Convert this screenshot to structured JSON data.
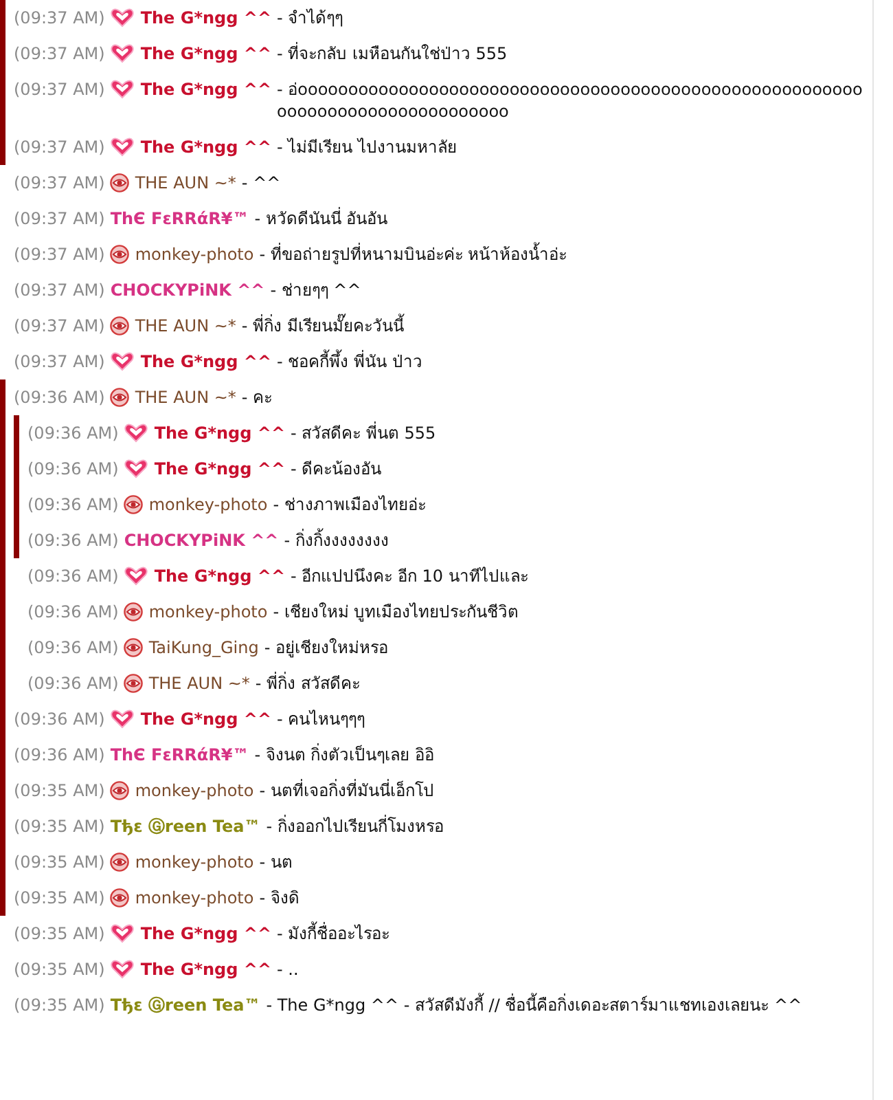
{
  "blocks": [
    {
      "quoted": true,
      "messages": [
        {
          "time": "(09:37 AM)",
          "kind": "heart",
          "sender": "The G*ngg ^^",
          "color": "#c8102e",
          "bold": true,
          "text": "- จำได้ๆๆ"
        },
        {
          "time": "(09:37 AM)",
          "kind": "heart",
          "sender": "The G*ngg ^^",
          "color": "#c8102e",
          "bold": true,
          "text": "- ที่จะกลับ เมหือนกันใช่ป่าว 555"
        },
        {
          "time": "(09:37 AM)",
          "kind": "heart",
          "sender": "The G*ngg ^^",
          "color": "#c8102e",
          "bold": true,
          "text": "- อ่ooooooooooooooooooooooooooooooooooooooooooooooooooooooooooooooooooooooooooooooo"
        },
        {
          "time": "(09:37 AM)",
          "kind": "heart",
          "sender": "The G*ngg ^^",
          "color": "#c8102e",
          "bold": true,
          "text": "- ไม่มีเรียน ไปงานมหาลัย"
        }
      ]
    },
    {
      "quoted": false,
      "messages": [
        {
          "time": "(09:37 AM)",
          "kind": "eye",
          "sender": "THE AUN ~*",
          "color": "#7a4a2a",
          "bold": false,
          "text": "- ^^"
        },
        {
          "time": "(09:37 AM)",
          "kind": "plain",
          "sender": "ThЄ FεRRάR¥™",
          "color": "#d63384",
          "bold": true,
          "text": "- หวัดดีนันนี่ อันอัน"
        },
        {
          "time": "(09:37 AM)",
          "kind": "eye",
          "sender": "monkey-photo",
          "color": "#7a4a2a",
          "bold": false,
          "text": "- ที่ขอถ่ายรูปที่หนามบินอ่ะค่ะ หน้าห้องน้ำอ่ะ"
        },
        {
          "time": "(09:37 AM)",
          "kind": "plain",
          "sender": "CHOCKYPiNK ^^",
          "color": "#d63384",
          "bold": true,
          "text": "- ช่ายๆๆ ^^"
        },
        {
          "time": "(09:37 AM)",
          "kind": "eye",
          "sender": "THE AUN ~*",
          "color": "#7a4a2a",
          "bold": false,
          "text": "- พี่กิ่ง มีเรียนมั๊ยคะวันนี้"
        },
        {
          "time": "(09:37 AM)",
          "kind": "heart",
          "sender": "The G*ngg ^^",
          "color": "#c8102e",
          "bold": true,
          "text": "- ชอคกี้พึ้ง พี่นัน ป่าว"
        }
      ]
    },
    {
      "quoted": true,
      "messages": [
        {
          "time": "(09:36 AM)",
          "kind": "eye",
          "sender": "THE AUN ~*",
          "color": "#7a4a2a",
          "bold": false,
          "text": "- คะ"
        }
      ],
      "children": [
        {
          "quoted": true,
          "messages": [
            {
              "time": "(09:36 AM)",
              "kind": "heart",
              "sender": "The G*ngg ^^",
              "color": "#c8102e",
              "bold": true,
              "text": "- สวัสดีคะ พี่นต 555"
            },
            {
              "time": "(09:36 AM)",
              "kind": "heart",
              "sender": "The G*ngg ^^",
              "color": "#c8102e",
              "bold": true,
              "text": "- ดีคะน้องอัน"
            },
            {
              "time": "(09:36 AM)",
              "kind": "eye",
              "sender": "monkey-photo",
              "color": "#7a4a2a",
              "bold": false,
              "text": "- ช่างภาพเมืองไทยอ่ะ"
            },
            {
              "time": "(09:36 AM)",
              "kind": "plain",
              "sender": "CHOCKYPiNK ^^",
              "color": "#d63384",
              "bold": true,
              "text": "- กิ่งกิ้งงงงงงงง"
            }
          ]
        },
        {
          "quoted": false,
          "messages": [
            {
              "time": "(09:36 AM)",
              "kind": "heart",
              "sender": "The G*ngg ^^",
              "color": "#c8102e",
              "bold": true,
              "text": "- อีกแปปนึงคะ อีก 10 นาทีไปและ"
            },
            {
              "time": "(09:36 AM)",
              "kind": "eye",
              "sender": "monkey-photo",
              "color": "#7a4a2a",
              "bold": false,
              "text": "- เชียงใหม่ บูทเมืองไทยประกันชีวิต"
            },
            {
              "time": "(09:36 AM)",
              "kind": "eye",
              "sender": "TaiKung_Ging",
              "color": "#7a4a2a",
              "bold": false,
              "text": "- อยู่เชียงใหม่หรอ"
            },
            {
              "time": "(09:36 AM)",
              "kind": "eye",
              "sender": "THE AUN ~*",
              "color": "#7a4a2a",
              "bold": false,
              "text": "- พี่กิ่ง สวัสดีคะ"
            }
          ]
        }
      ]
    },
    {
      "quoted": true,
      "messages": [
        {
          "time": "(09:36 AM)",
          "kind": "heart",
          "sender": "The G*ngg ^^",
          "color": "#c8102e",
          "bold": true,
          "text": "- คนไหนๆๆๆ"
        },
        {
          "time": "(09:36 AM)",
          "kind": "plain",
          "sender": "ThЄ FεRRάR¥™",
          "color": "#d63384",
          "bold": true,
          "text": "- จิงนต กิ่งตัวเป็นๆเลย อิอิ"
        },
        {
          "time": "(09:35 AM)",
          "kind": "eye",
          "sender": "monkey-photo",
          "color": "#7a4a2a",
          "bold": false,
          "text": "- นตที่เจอกิ่งที่มันนี่เอ็กโป"
        },
        {
          "time": "(09:35 AM)",
          "kind": "plain",
          "sender": "Tђε Ⓖreen Tea™",
          "color": "#8a8a12",
          "bold": true,
          "text": "- กิ่งออกไปเรียนกี่โมงหรอ"
        },
        {
          "time": "(09:35 AM)",
          "kind": "eye",
          "sender": "monkey-photo",
          "color": "#7a4a2a",
          "bold": false,
          "text": "- นต"
        },
        {
          "time": "(09:35 AM)",
          "kind": "eye",
          "sender": "monkey-photo",
          "color": "#7a4a2a",
          "bold": false,
          "text": "- จิงดิ"
        }
      ]
    },
    {
      "quoted": false,
      "messages": [
        {
          "time": "(09:35 AM)",
          "kind": "heart",
          "sender": "The G*ngg ^^",
          "color": "#c8102e",
          "bold": true,
          "text": "- มังกี้ชื่ออะไรอะ"
        },
        {
          "time": "(09:35 AM)",
          "kind": "heart",
          "sender": "The G*ngg ^^",
          "color": "#c8102e",
          "bold": true,
          "text": "- .."
        },
        {
          "time": "(09:35 AM)",
          "kind": "plain",
          "sender": "Tђε Ⓖreen Tea™",
          "color": "#8a8a12",
          "bold": true,
          "text": "- The G*ngg ^^ - สวัสดีมังกี้ // ชื่อนี้คือกิ่งเดอะสตาร์มาแชทเองเลยนะ ^^"
        }
      ]
    }
  ]
}
